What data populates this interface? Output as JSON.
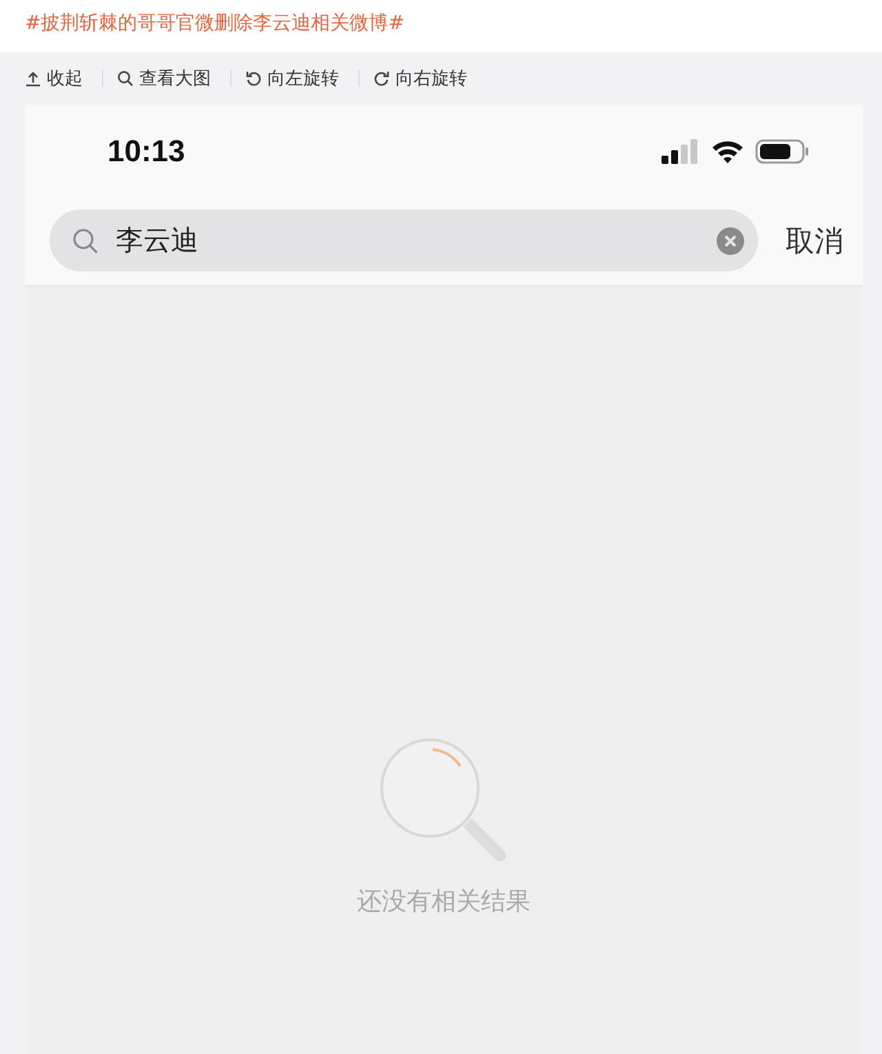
{
  "topic": "#披荆斩棘的哥哥官微删除李云迪相关微博#",
  "toolbar": [
    {
      "kind": "collapse",
      "label": "收起"
    },
    {
      "kind": "zoom",
      "label": "查看大图"
    },
    {
      "kind": "rotate-left",
      "label": "向左旋转"
    },
    {
      "kind": "rotate-right",
      "label": "向右旋转"
    }
  ],
  "phone": {
    "status_bar": {
      "time": "10:13"
    },
    "search": {
      "value": "李云迪",
      "cancel": "取消"
    },
    "empty_state": {
      "message": "还没有相关结果"
    }
  }
}
